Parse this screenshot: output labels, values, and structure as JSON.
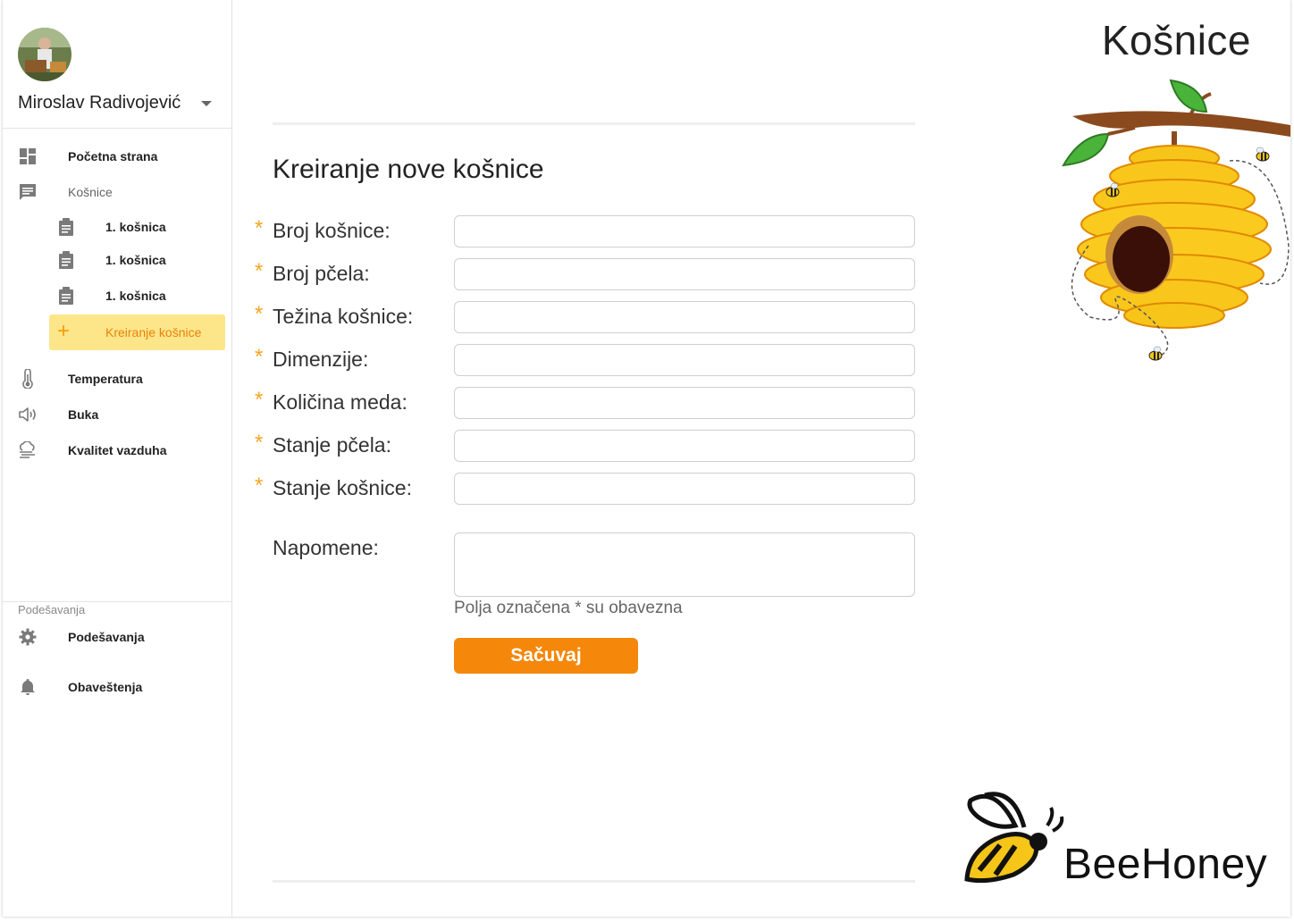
{
  "sidebar": {
    "user_name": "Miroslav Radivojević",
    "items": [
      {
        "label": "Početna strana",
        "icon": "dashboard-icon"
      },
      {
        "label": "Košnice",
        "icon": "message-icon"
      },
      {
        "label": "1. košnica",
        "icon": "clipboard-icon"
      },
      {
        "label": "1. košnica",
        "icon": "clipboard-icon"
      },
      {
        "label": "1. košnica",
        "icon": "clipboard-icon"
      },
      {
        "label": "Kreiranje košnice",
        "icon": "plus-icon"
      },
      {
        "label": "Temperatura",
        "icon": "thermometer-icon"
      },
      {
        "label": "Buka",
        "icon": "speaker-icon"
      },
      {
        "label": "Kvalitet vazduha",
        "icon": "air-quality-icon"
      }
    ],
    "settings_section": "Podešavanja",
    "settings_items": [
      {
        "label": "Podešavanja",
        "icon": "gear-icon"
      },
      {
        "label": "Obaveštenja",
        "icon": "bell-icon"
      }
    ]
  },
  "header": {
    "title": "Košnice"
  },
  "form": {
    "title": "Kreiranje nove košnice",
    "required_mark": "*",
    "fields": [
      {
        "label": "Broj košnice:",
        "value": ""
      },
      {
        "label": "Broj pčela:",
        "value": ""
      },
      {
        "label": "Težina košnice:",
        "value": ""
      },
      {
        "label": "Dimenzije:",
        "value": ""
      },
      {
        "label": "Količina meda:",
        "value": ""
      },
      {
        "label": "Stanje pčela:",
        "value": ""
      },
      {
        "label": "Stanje košnice:",
        "value": ""
      }
    ],
    "notes_label": "Napomene:",
    "notes_value": "",
    "hint": "Polja označena * su obavezna",
    "save_label": "Sačuvaj"
  },
  "brand": {
    "name": "BeeHoney"
  },
  "colors": {
    "accent": "#f5870a",
    "active_bg": "#fde68a",
    "required": "#f5a623"
  }
}
